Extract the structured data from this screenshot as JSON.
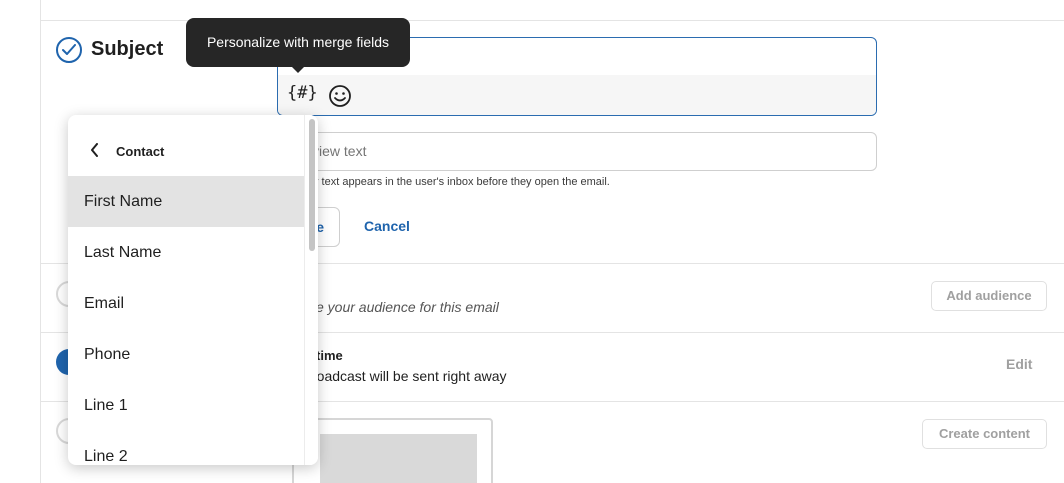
{
  "subject": {
    "title": "Subject",
    "tooltip": "Personalize with merge fields",
    "merge_icon_glyph": "{#}",
    "merge_icon": "merge-fields-icon",
    "emoji_icon": "smiley-icon",
    "preview_placeholder": "view text",
    "preview_help": "y text appears in the user's inbox before they open the email.",
    "save_label": "e",
    "cancel_label": "Cancel"
  },
  "audience": {
    "subtitle": "e your audience for this email",
    "button_label": "Add audience"
  },
  "send_time": {
    "title": "time",
    "subtitle": "roadcast will be sent right away",
    "edit_label": "Edit"
  },
  "content": {
    "button_label": "Create content"
  },
  "dropdown": {
    "title": "Contact",
    "back_icon": "chevron-left-icon",
    "items": [
      {
        "label": "First Name",
        "selected": true
      },
      {
        "label": "Last Name",
        "selected": false
      },
      {
        "label": "Email",
        "selected": false
      },
      {
        "label": "Phone",
        "selected": false
      },
      {
        "label": "Line 1",
        "selected": false
      },
      {
        "label": "Line 2",
        "selected": false
      }
    ]
  },
  "colors": {
    "accent": "#1f64ad",
    "tooltip_bg": "#262626",
    "selected_row": "#e3e3e3",
    "disabled_text": "#a0a0a0"
  }
}
